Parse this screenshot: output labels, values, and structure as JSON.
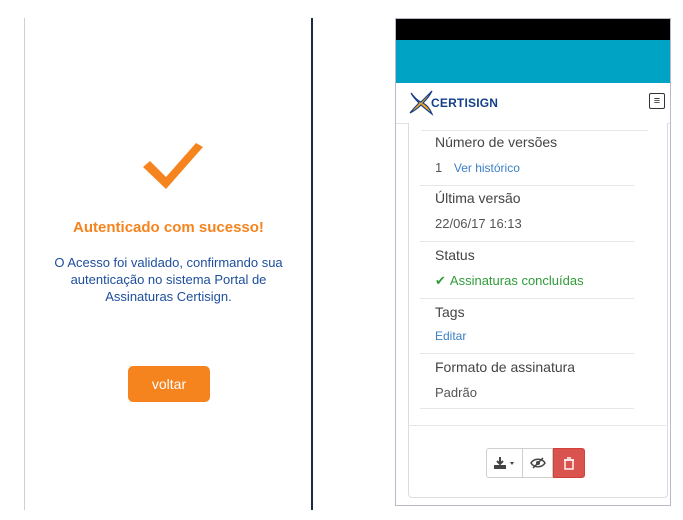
{
  "left": {
    "title": "Autenticado com sucesso!",
    "message": "O Acesso foi validado, confirmando sua autenticação no sistema Portal de Assinaturas Certisign.",
    "back_label": "voltar",
    "colors": {
      "accent": "#f5841f",
      "text": "#1d4e9c"
    }
  },
  "right": {
    "brand": "CERTISIGN",
    "menu_icon": "≡",
    "details": [
      {
        "label": "Número de versões",
        "value": "1",
        "link": "Ver histórico"
      },
      {
        "label": "Última versão",
        "value": "22/06/17 16:13"
      },
      {
        "label": "Status",
        "value": "Assinaturas concluídas",
        "icon": "check-icon"
      },
      {
        "label": "Tags",
        "link": "Editar"
      },
      {
        "label": "Formato de assinatura",
        "value": "Padrão"
      }
    ],
    "colors": {
      "appbar": "#00a3c4",
      "delete": "#d9534f",
      "status_ok": "#2f9c38"
    }
  }
}
